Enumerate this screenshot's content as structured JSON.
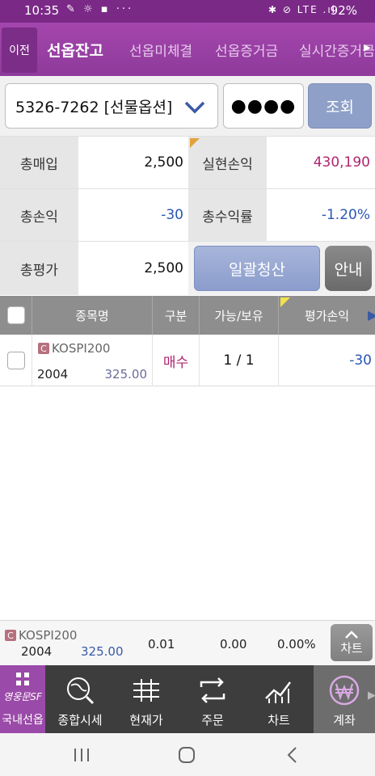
{
  "status_bar": {
    "time": "10:35",
    "left_icons": "✎ ☼ ▪ ···",
    "right_icons": "✱ ⊘ LTE .ıl",
    "battery": "92%"
  },
  "top_tabs": {
    "back_label": "이전",
    "tabs": [
      "선옵잔고",
      "선옵미체결",
      "선옵증거금",
      "실시간증거금"
    ],
    "active_index": 0
  },
  "account": {
    "account_text": "5326-7262 [선물옵션]",
    "password_masked": "●●●●",
    "query_button": "조회"
  },
  "summary": {
    "total_buy_label": "총매입",
    "total_buy_value": "2,500",
    "realized_pl_label": "실현손익",
    "realized_pl_value": "430,190",
    "total_pl_label": "총손익",
    "total_pl_value": "-30",
    "total_return_label": "총수익률",
    "total_return_value": "-1.20%",
    "total_eval_label": "총평가",
    "total_eval_value": "2,500",
    "bulk_close_button": "일괄청산",
    "guide_button": "안내"
  },
  "table": {
    "headers": [
      "종목명",
      "구분",
      "가능/보유",
      "평가손익"
    ],
    "rows": [
      {
        "badge": "C",
        "name": "KOSPI200",
        "code": "2004",
        "strike": "325.00",
        "side": "매수",
        "qty": "1 / 1",
        "eval_pl": "-30"
      }
    ]
  },
  "ticker": {
    "badge": "C",
    "name": "KOSPI200",
    "code": "2004",
    "strike": "325.00",
    "v1": "0.01",
    "v2": "0.00",
    "v3": "0.00%",
    "chart_button": "차트"
  },
  "bottom_nav": {
    "logo_text": "영웅문SF",
    "items": [
      "국내선옵",
      "종합시세",
      "현재가",
      "주문",
      "차트",
      "계좌"
    ],
    "active_index": 5
  },
  "colors": {
    "purple": "#9a44a6",
    "positive": "#b0256d",
    "negative": "#2a55b8"
  }
}
